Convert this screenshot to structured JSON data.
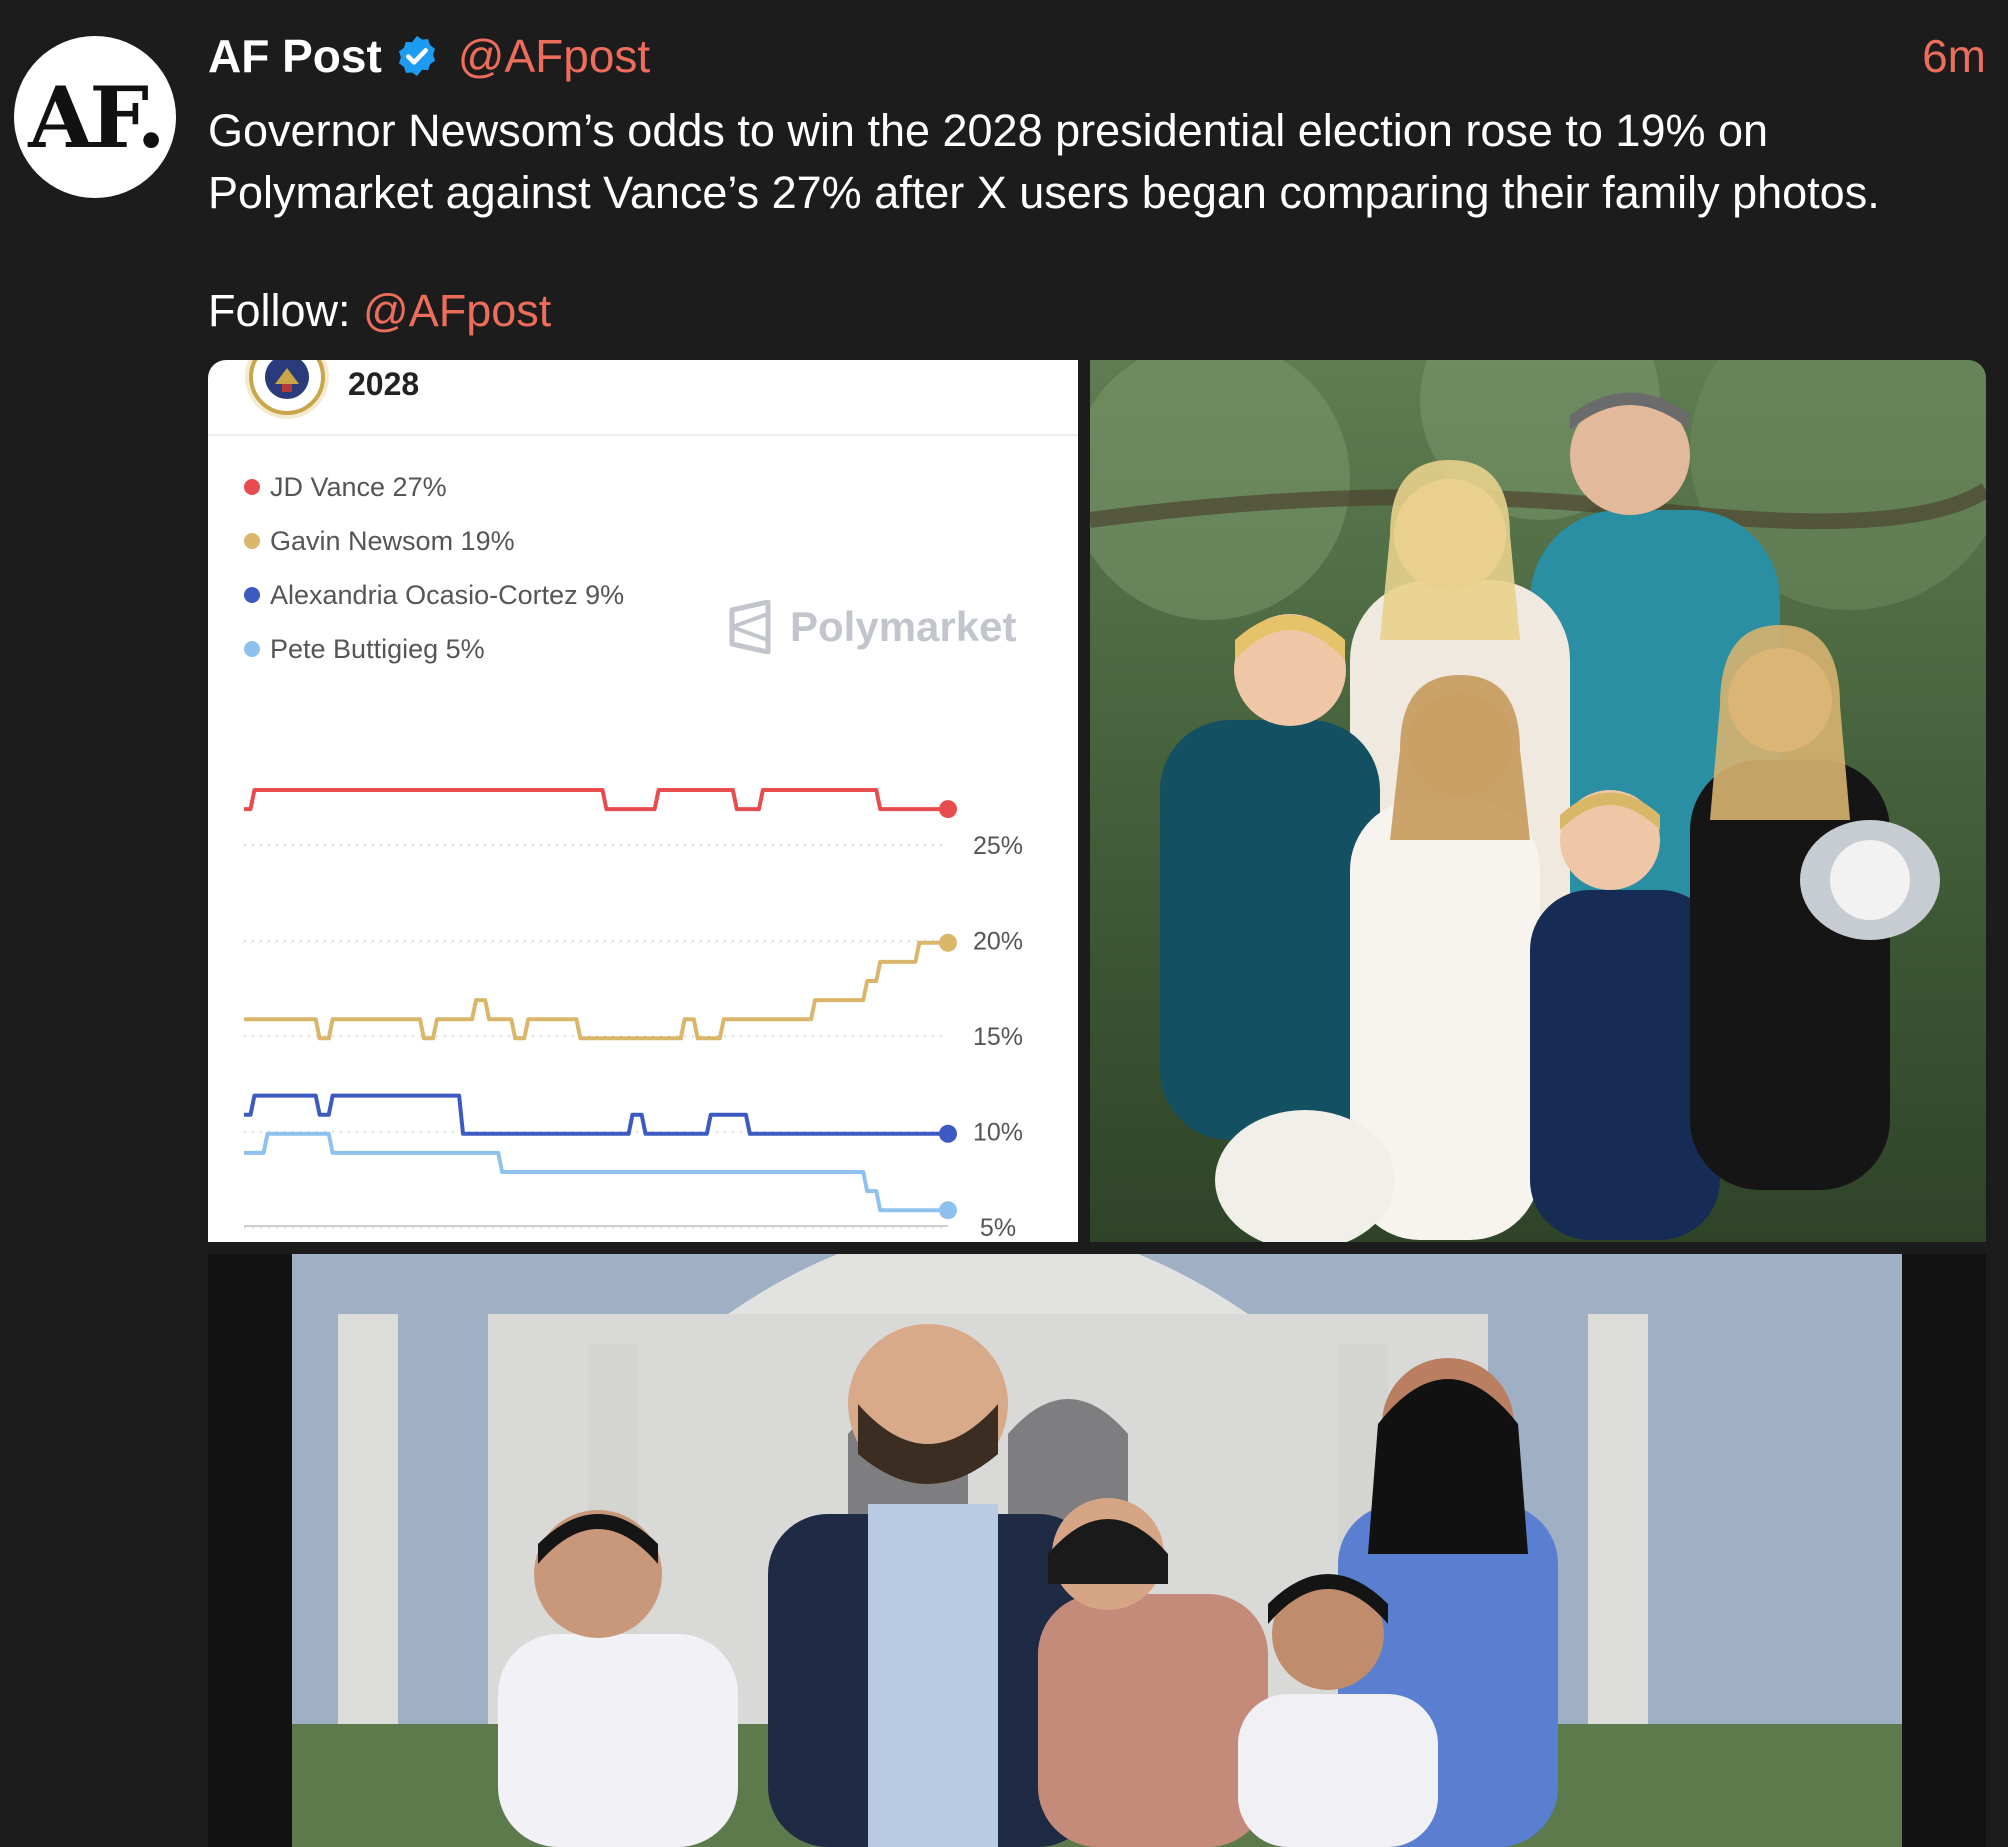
{
  "post": {
    "avatar_text": "AF.",
    "author": "AF Post",
    "handle": "@AFpost",
    "time": "6m",
    "text_line1": "Governor Newsom’s odds to win the 2028 presidential election rose to 19% on",
    "text_line2": "Polymarket against Vance’s 27% after X users began comparing their family photos.",
    "follow_label": "Follow: ",
    "follow_handle": "@AFpost",
    "colors": {
      "background": "#1c1c1c",
      "link": "#ec6d5b",
      "verified": "#1d9bf0"
    },
    "icons": [
      "verified-badge-icon",
      "presidential-seal-icon",
      "polymarket-logo-icon"
    ]
  },
  "media": {
    "chart_year": "2028",
    "watermark": "Polymarket"
  },
  "chart_data": {
    "type": "line",
    "title": "2028",
    "yticks": [
      "25%",
      "20%",
      "15%",
      "10%",
      "5%"
    ],
    "ylim": [
      2,
      29
    ],
    "x": [
      0,
      1,
      2,
      3,
      4,
      5,
      6,
      7,
      8,
      9,
      10,
      11,
      12,
      13,
      14,
      15,
      16,
      17,
      18,
      19,
      20,
      21,
      22,
      23,
      24,
      25,
      26,
      27,
      28,
      29,
      30,
      31,
      32,
      33,
      34,
      35,
      36,
      37,
      38,
      39,
      40,
      41,
      42,
      43,
      44,
      45,
      46,
      47,
      48,
      49,
      50,
      51,
      52,
      53,
      54
    ],
    "legend_position": "top-left",
    "grid": true,
    "series": [
      {
        "name": "JD Vance 27%",
        "color": "#e84c4f",
        "values": [
          26,
          27,
          27,
          27,
          27,
          27,
          27,
          27,
          27,
          27,
          27,
          27,
          27,
          27,
          27,
          27,
          27,
          27,
          27,
          27,
          27,
          27,
          27,
          27,
          27,
          27,
          27,
          27,
          26,
          26,
          26,
          26,
          27,
          27,
          27,
          27,
          27,
          27,
          26,
          26,
          27,
          27,
          27,
          27,
          27,
          27,
          27,
          27,
          27,
          26,
          26,
          26,
          26,
          26,
          26
        ]
      },
      {
        "name": "Gavin Newsom 19%",
        "color": "#dab66a",
        "values": [
          15,
          15,
          15,
          15,
          15,
          15,
          14,
          15,
          15,
          15,
          15,
          15,
          15,
          15,
          14,
          15,
          15,
          15,
          16,
          15,
          15,
          14,
          15,
          15,
          15,
          15,
          14,
          14,
          14,
          14,
          14,
          14,
          14,
          14,
          15,
          14,
          14,
          15,
          15,
          15,
          15,
          15,
          15,
          15,
          16,
          16,
          16,
          16,
          17,
          18,
          18,
          18,
          19,
          19,
          19
        ]
      },
      {
        "name": "Alexandria Ocasio-Cortez 9%",
        "color": "#3d5ac2",
        "values": [
          10,
          11,
          11,
          11,
          11,
          11,
          10,
          11,
          11,
          11,
          11,
          11,
          11,
          11,
          11,
          11,
          11,
          9,
          9,
          9,
          9,
          9,
          9,
          9,
          9,
          9,
          9,
          9,
          9,
          9,
          10,
          9,
          9,
          9,
          9,
          9,
          10,
          10,
          10,
          9,
          9,
          9,
          9,
          9,
          9,
          9,
          9,
          9,
          9,
          9,
          9,
          9,
          9,
          9,
          9
        ]
      },
      {
        "name": "Pete Buttigieg 5%",
        "color": "#8fc1ee",
        "values": [
          8,
          8,
          9,
          9,
          9,
          9,
          9,
          8,
          8,
          8,
          8,
          8,
          8,
          8,
          8,
          8,
          8,
          8,
          8,
          8,
          7,
          7,
          7,
          7,
          7,
          7,
          7,
          7,
          7,
          7,
          7,
          7,
          7,
          7,
          7,
          7,
          7,
          7,
          7,
          7,
          7,
          7,
          7,
          7,
          7,
          7,
          7,
          7,
          6,
          5,
          5,
          5,
          5,
          5,
          5
        ]
      }
    ]
  }
}
